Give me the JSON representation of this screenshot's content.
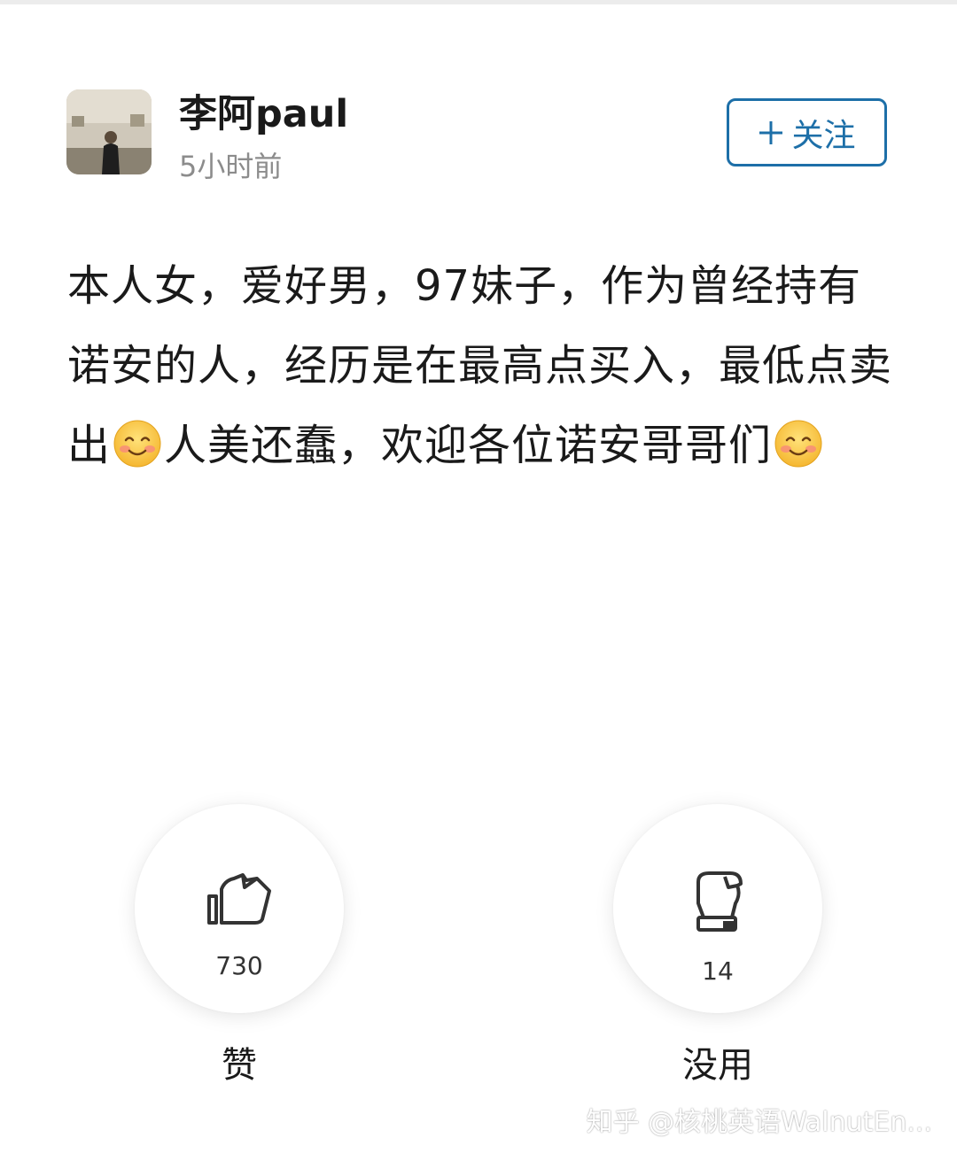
{
  "author": {
    "name": "李阿paul",
    "time": "5小时前"
  },
  "follow": {
    "label": "关注",
    "icon": "plus-icon"
  },
  "post": {
    "segments": [
      "本人女，爱好男，97妹子，作为曾经持有诺安的人，经历是在最高点买入，最低点卖出",
      "人美还蠢，欢迎各位诺安哥哥们"
    ],
    "emoji_icon": "smiling-face-icon"
  },
  "votes": {
    "like": {
      "count": "730",
      "label": "赞",
      "icon": "thumbs-up-icon"
    },
    "useless": {
      "count": "14",
      "label": "没用",
      "icon": "fist-icon"
    }
  },
  "watermark": "知乎 @核桃英语WalnutEn...",
  "colors": {
    "accent": "#1d6fa8",
    "text": "#1a1a1a",
    "muted": "#8c8c8c"
  }
}
